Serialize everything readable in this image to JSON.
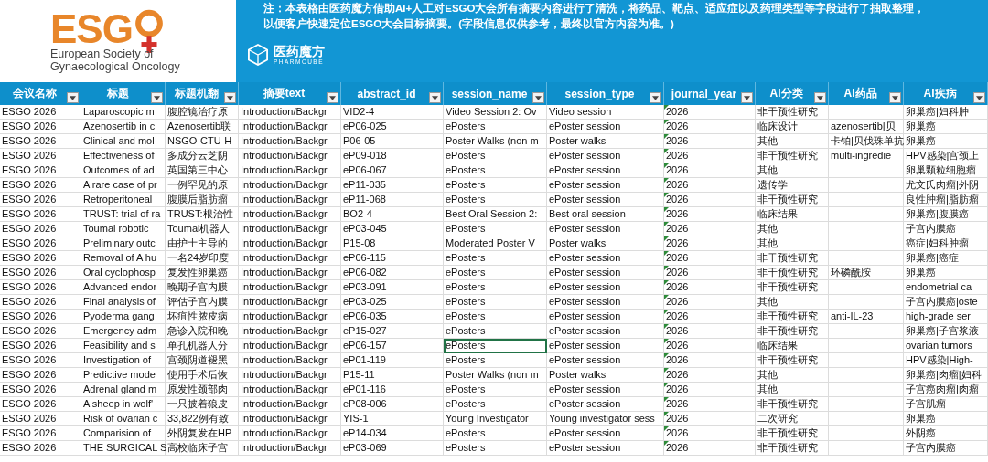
{
  "logo": {
    "wordmark": "ESG",
    "tagline": [
      "European Society of",
      "Gynaecological Oncology"
    ]
  },
  "notice": [
    "注：本表格由医药魔方借助AI+人工对ESGO大会所有摘要内容进行了清洗，将药品、靶点、适应症以及药理类型等字段进行了抽取整理，",
    "以便客户快速定位ESGO大会目标摘要。(字段信息仅供参考，最终以官方内容为准。)"
  ],
  "brand": {
    "name": "医药魔方",
    "subtitle": "PHARMCUBE"
  },
  "table": {
    "columns": [
      {
        "label": "会议名称",
        "selected": false,
        "warning": false
      },
      {
        "label": "标题",
        "selected": false,
        "warning": false
      },
      {
        "label": "标题机翻",
        "selected": false,
        "warning": false
      },
      {
        "label": "摘要text",
        "selected": false,
        "warning": false
      },
      {
        "label": "abstract_id",
        "selected": false,
        "warning": false
      },
      {
        "label": "session_name",
        "selected": true,
        "warning": false
      },
      {
        "label": "session_type",
        "selected": false,
        "warning": false
      },
      {
        "label": "journal_year",
        "selected": false,
        "warning": true
      },
      {
        "label": "AI分类",
        "selected": false,
        "warning": false
      },
      {
        "label": "AI药品",
        "selected": false,
        "warning": false
      },
      {
        "label": "AI疾病",
        "selected": false,
        "warning": false
      }
    ],
    "rows": [
      {
        "selected": false,
        "cells": [
          "ESGO 2026",
          "Laparoscopic m",
          "腹腔镜治疗原",
          "Introduction/Backgr",
          "VID2-4",
          "Video Session 2: Ov",
          "Video session",
          "2026",
          "非干预性研究",
          null,
          "卵巢癌|妇科肿"
        ]
      },
      {
        "selected": false,
        "cells": [
          "ESGO 2026",
          "Azenosertib in c",
          "Azenosertib联",
          "Introduction/Backgr",
          "eP06-025",
          "ePosters",
          "ePoster session",
          "2026",
          "临床设计",
          "azenosertib|贝",
          "卵巢癌"
        ]
      },
      {
        "selected": false,
        "cells": [
          "ESGO 2026",
          "Clinical and mol",
          "NSGO-CTU-H",
          "Introduction/Backgr",
          "P06-05",
          "Poster Walks (non m",
          "Poster walks",
          "2026",
          "其他",
          "卡铂|贝伐珠单抗",
          "卵巢癌"
        ]
      },
      {
        "selected": false,
        "cells": [
          "ESGO 2026",
          "Effectiveness of",
          "多成分云芝阴",
          "Introduction/Backgr",
          "eP09-018",
          "ePosters",
          "ePoster session",
          "2026",
          "非干预性研究",
          "multi-ingredie",
          "HPV感染|宫颈上"
        ]
      },
      {
        "selected": false,
        "cells": [
          "ESGO 2026",
          "Outcomes of ad",
          "英国第三中心",
          "Introduction/Backgr",
          "eP06-067",
          "ePosters",
          "ePoster session",
          "2026",
          "其他",
          null,
          "卵巢颗粒细胞瘤"
        ]
      },
      {
        "selected": false,
        "cells": [
          "ESGO 2026",
          "A rare case of pr",
          "一例罕见的原",
          "Introduction/Backgr",
          "eP11-035",
          "ePosters",
          "ePoster session",
          "2026",
          "遗传学",
          null,
          "尤文氏肉瘤|外阴"
        ]
      },
      {
        "selected": false,
        "cells": [
          "ESGO 2026",
          "Retroperitoneal",
          "腹膜后脂肪瘤",
          "Introduction/Backgr",
          "eP11-068",
          "ePosters",
          "ePoster session",
          "2026",
          "非干预性研究",
          null,
          "良性肿瘤|脂肪瘤"
        ]
      },
      {
        "selected": false,
        "cells": [
          "ESGO 2026",
          "TRUST: trial of ra",
          "TRUST:根治性",
          "Introduction/Backgr",
          "BO2-4",
          "Best Oral Session 2:",
          "Best oral session",
          "2026",
          "临床结果",
          null,
          "卵巢癌|腹膜癌"
        ]
      },
      {
        "selected": false,
        "cells": [
          "ESGO 2026",
          "Toumai robotic",
          "Toumai机器人",
          "Introduction/Backgr",
          "eP03-045",
          "ePosters",
          "ePoster session",
          "2026",
          "其他",
          null,
          "子宫内膜癌"
        ]
      },
      {
        "selected": false,
        "cells": [
          "ESGO 2026",
          "Preliminary outc",
          "由护士主导的",
          "Introduction/Backgr",
          "P15-08",
          "Moderated Poster V",
          "Poster walks",
          "2026",
          "其他",
          null,
          "癌症|妇科肿瘤"
        ]
      },
      {
        "selected": false,
        "cells": [
          "ESGO 2026",
          "Removal of A hu",
          "一名24岁印度",
          "Introduction/Backgr",
          "eP06-115",
          "ePosters",
          "ePoster session",
          "2026",
          "非干预性研究",
          null,
          "卵巢癌|癌症"
        ]
      },
      {
        "selected": false,
        "cells": [
          "ESGO 2026",
          "Oral cyclophosp",
          "复发性卵巢癌",
          "Introduction/Backgr",
          "eP06-082",
          "ePosters",
          "ePoster session",
          "2026",
          "非干预性研究",
          "环磷酰胺",
          "卵巢癌"
        ]
      },
      {
        "selected": false,
        "cells": [
          "ESGO 2026",
          "Advanced endor",
          "晚期子宫内膜",
          "Introduction/Backgr",
          "eP03-091",
          "ePosters",
          "ePoster session",
          "2026",
          "非干预性研究",
          null,
          "endometrial ca"
        ]
      },
      {
        "selected": false,
        "cells": [
          "ESGO 2026",
          "Final analysis of",
          "评估子宫内膜",
          "Introduction/Backgr",
          "eP03-025",
          "ePosters",
          "ePoster session",
          "2026",
          "其他",
          null,
          "子宫内膜癌|oste"
        ]
      },
      {
        "selected": false,
        "cells": [
          "ESGO 2026",
          "Pyoderma gang",
          "坏疽性脓皮病",
          "Introduction/Backgr",
          "eP06-035",
          "ePosters",
          "ePoster session",
          "2026",
          "非干预性研究",
          "anti-IL-23",
          "high-grade ser"
        ]
      },
      {
        "selected": false,
        "cells": [
          "ESGO 2026",
          "Emergency adm",
          "急诊入院和晚",
          "Introduction/Backgr",
          "eP15-027",
          "ePosters",
          "ePoster session",
          "2026",
          "非干预性研究",
          null,
          "卵巢癌|子宫浆液"
        ]
      },
      {
        "selected": true,
        "cells": [
          "ESGO 2026",
          "Feasibility and s",
          "单孔机器人分",
          "Introduction/Backgr",
          "eP06-157",
          "ePosters",
          "ePoster session",
          "2026",
          "临床结果",
          null,
          "ovarian tumors"
        ]
      },
      {
        "selected": false,
        "cells": [
          "ESGO 2026",
          "Investigation of",
          "宫颈阴道褪黑",
          "Introduction/Backgr",
          "eP01-119",
          "ePosters",
          "ePoster session",
          "2026",
          "非干预性研究",
          null,
          "HPV感染|High-"
        ]
      },
      {
        "selected": false,
        "cells": [
          "ESGO 2026",
          "Predictive mode",
          "使用手术后恢",
          "Introduction/Backgr",
          "P15-11",
          "Poster Walks (non m",
          "Poster walks",
          "2026",
          "其他",
          null,
          "卵巢癌|肉瘤|妇科"
        ]
      },
      {
        "selected": false,
        "cells": [
          "ESGO 2026",
          "Adrenal gland m",
          "原发性颈部肉",
          "Introduction/Backgr",
          "eP01-116",
          "ePosters",
          "ePoster session",
          "2026",
          "其他",
          null,
          "子宫癌肉瘤|肉瘤"
        ]
      },
      {
        "selected": false,
        "cells": [
          "ESGO 2026",
          "A sheep in wolf'",
          "一只披着狼皮",
          "Introduction/Backgr",
          "eP08-006",
          "ePosters",
          "ePoster session",
          "2026",
          "非干预性研究",
          null,
          "子宫肌瘤"
        ]
      },
      {
        "selected": false,
        "cells": [
          "ESGO 2026",
          "Risk of ovarian c",
          "33,822例有致",
          "Introduction/Backgr",
          "YIS-1",
          "Young Investigator",
          "Young investigator sess",
          "2026",
          "二次研究",
          null,
          "卵巢癌"
        ]
      },
      {
        "selected": false,
        "cells": [
          "ESGO 2026",
          "Comparision of",
          "外阴复发在HP",
          "Introduction/Backgr",
          "eP14-034",
          "ePosters",
          "ePoster session",
          "2026",
          "非干预性研究",
          null,
          "外阴癌"
        ]
      },
      {
        "selected": false,
        "cells": [
          "ESGO 2026",
          "THE SURGICAL S",
          "高校临床子宫",
          "Introduction/Backgr",
          "eP03-069",
          "ePosters",
          "ePoster session",
          "2026",
          "非干预性研究",
          null,
          "子宫内膜癌"
        ]
      }
    ]
  }
}
